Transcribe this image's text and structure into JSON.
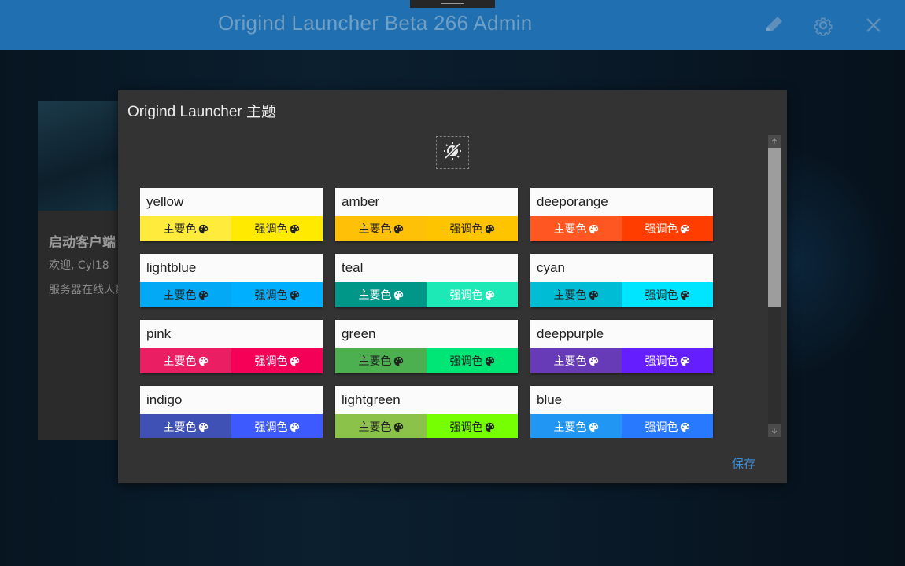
{
  "window": {
    "title": "Origind Launcher Beta 266 Admin",
    "titlebar_color": "#1f6fb1",
    "icons": [
      "pen-icon",
      "gear-icon",
      "close-icon"
    ]
  },
  "background_card": {
    "heading": "启动客户端",
    "welcome": "欢迎, Cyl18",
    "status": "服务器在线人数"
  },
  "dialog": {
    "title": "Origind Launcher 主题",
    "toggle_icon": "theme-brightness-icon",
    "save_label": "保存",
    "themes": [
      {
        "name": "yellow",
        "primary_label": "主要色",
        "accent_label": "强调色",
        "primary": "#ffeb3b",
        "accent": "#ffea00",
        "primary_text": "#222",
        "accent_text": "#222"
      },
      {
        "name": "amber",
        "primary_label": "主要色",
        "accent_label": "强调色",
        "primary": "#ffc107",
        "accent": "#ffc400",
        "primary_text": "#222",
        "accent_text": "#222"
      },
      {
        "name": "deeporange",
        "primary_label": "主要色",
        "accent_label": "强调色",
        "primary": "#ff5722",
        "accent": "#ff3d00",
        "primary_text": "#fff",
        "accent_text": "#fff"
      },
      {
        "name": "lightblue",
        "primary_label": "主要色",
        "accent_label": "强调色",
        "primary": "#03a9f4",
        "accent": "#00b0ff",
        "primary_text": "#222",
        "accent_text": "#222"
      },
      {
        "name": "teal",
        "primary_label": "主要色",
        "accent_label": "强调色",
        "primary": "#009688",
        "accent": "#1de9b6",
        "primary_text": "#fff",
        "accent_text": "#fff"
      },
      {
        "name": "cyan",
        "primary_label": "主要色",
        "accent_label": "强调色",
        "primary": "#00bcd4",
        "accent": "#00e5ff",
        "primary_text": "#222",
        "accent_text": "#222"
      },
      {
        "name": "pink",
        "primary_label": "主要色",
        "accent_label": "强调色",
        "primary": "#e91e63",
        "accent": "#f50057",
        "primary_text": "#fff",
        "accent_text": "#fff"
      },
      {
        "name": "green",
        "primary_label": "主要色",
        "accent_label": "强调色",
        "primary": "#4caf50",
        "accent": "#00e676",
        "primary_text": "#222",
        "accent_text": "#222"
      },
      {
        "name": "deeppurple",
        "primary_label": "主要色",
        "accent_label": "强调色",
        "primary": "#673ab7",
        "accent": "#651fff",
        "primary_text": "#fff",
        "accent_text": "#fff"
      },
      {
        "name": "indigo",
        "primary_label": "主要色",
        "accent_label": "强调色",
        "primary": "#3f51b5",
        "accent": "#3d5afe",
        "primary_text": "#fff",
        "accent_text": "#fff"
      },
      {
        "name": "lightgreen",
        "primary_label": "主要色",
        "accent_label": "强调色",
        "primary": "#8bc34a",
        "accent": "#76ff03",
        "primary_text": "#222",
        "accent_text": "#222"
      },
      {
        "name": "blue",
        "primary_label": "主要色",
        "accent_label": "强调色",
        "primary": "#2196f3",
        "accent": "#2979ff",
        "primary_text": "#fff",
        "accent_text": "#fff"
      }
    ]
  }
}
